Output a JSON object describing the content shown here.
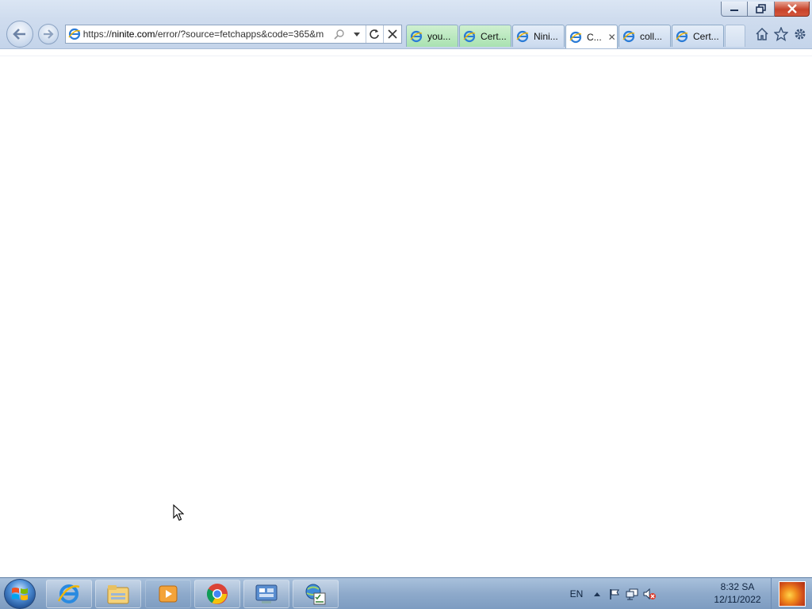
{
  "browser": {
    "address_bar": {
      "url_prefix": "https://",
      "url_host": "ninite.com",
      "url_path": "/error/?source=fetchapps&code=365&m"
    },
    "tabs": [
      {
        "label": "you...",
        "state": "inactive",
        "color": "green"
      },
      {
        "label": "Cert...",
        "state": "inactive",
        "color": "green"
      },
      {
        "label": "Nini...",
        "state": "inactive",
        "color": "blue"
      },
      {
        "label": "C...",
        "state": "active",
        "color": "white"
      },
      {
        "label": "coll...",
        "state": "inactive",
        "color": "blue"
      },
      {
        "label": "Cert...",
        "state": "inactive",
        "color": "blue"
      }
    ],
    "tab_close_glyph": "✕",
    "icons": [
      "back-icon",
      "forward-icon",
      "ie-page-icon",
      "search-icon",
      "dropdown-icon",
      "refresh-icon",
      "stop-icon",
      "home-icon",
      "favorites-star-icon",
      "tools-gear-icon"
    ]
  },
  "taskbar": {
    "pinned": [
      "internet-explorer-icon",
      "windows-explorer-icon",
      "media-player-icon",
      "chrome-icon",
      "control-panel-icon",
      "web-tool-icon"
    ],
    "tray": {
      "language": "EN",
      "icons": [
        "show-hidden-icons-icon",
        "action-center-flag-icon",
        "network-icon",
        "volume-muted-icon"
      ]
    },
    "clock": {
      "time": "8:32 SA",
      "date": "12/11/2022"
    }
  },
  "colors": {
    "chrome_bg": "#cfdcee",
    "taskbar_bg": "#8eaacb",
    "close_btn": "#c7432b",
    "tab_green": "#a9e2b1",
    "tab_blue": "#cbdaee"
  }
}
